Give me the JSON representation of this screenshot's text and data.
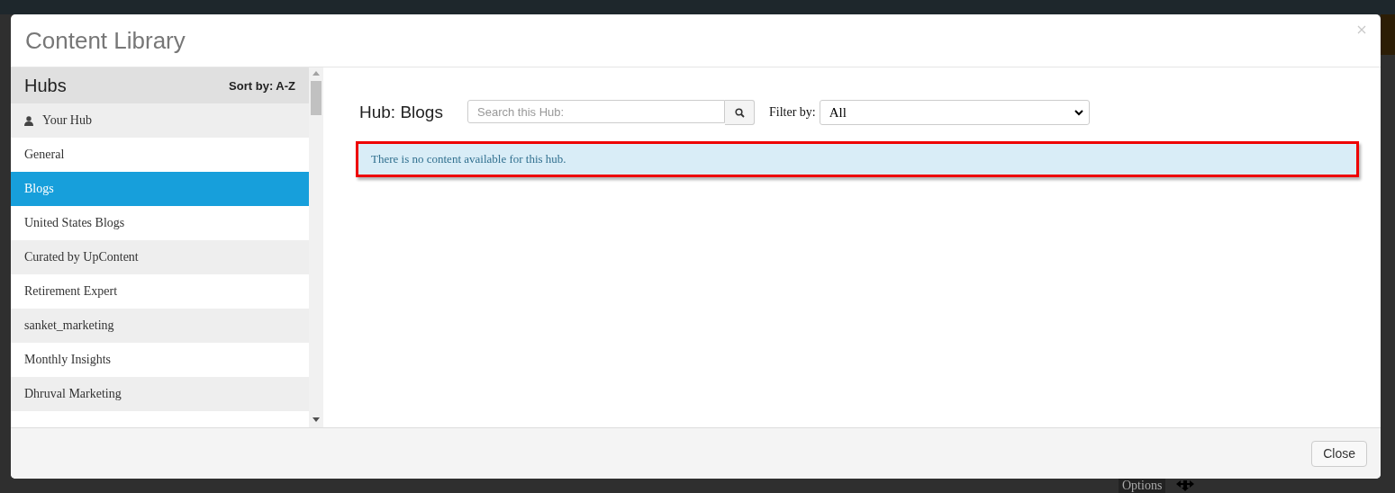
{
  "backdrop": {
    "options_label": "Options"
  },
  "modal": {
    "title": "Content Library",
    "sidebar": {
      "heading": "Hubs",
      "sort_label": "Sort by: A-Z",
      "items": [
        {
          "label": "Your Hub",
          "kind": "personal",
          "selected": false
        },
        {
          "label": "General",
          "kind": "hub",
          "selected": false
        },
        {
          "label": "Blogs",
          "kind": "hub",
          "selected": true
        },
        {
          "label": "United States Blogs",
          "kind": "hub",
          "selected": false
        },
        {
          "label": "Curated by UpContent",
          "kind": "hub",
          "selected": false
        },
        {
          "label": "Retirement Expert",
          "kind": "hub",
          "selected": false
        },
        {
          "label": "sanket_marketing",
          "kind": "hub",
          "selected": false
        },
        {
          "label": "Monthly Insights",
          "kind": "hub",
          "selected": false
        },
        {
          "label": "Dhruval Marketing",
          "kind": "hub",
          "selected": false
        }
      ]
    },
    "main": {
      "hub_title": "Hub: Blogs",
      "search": {
        "placeholder": "Search this Hub:"
      },
      "filter_label": "Filter by:",
      "filter_value": "All",
      "message": "There is no content available for this hub.",
      "message_highlighted": true
    },
    "footer_button": "Close"
  }
}
